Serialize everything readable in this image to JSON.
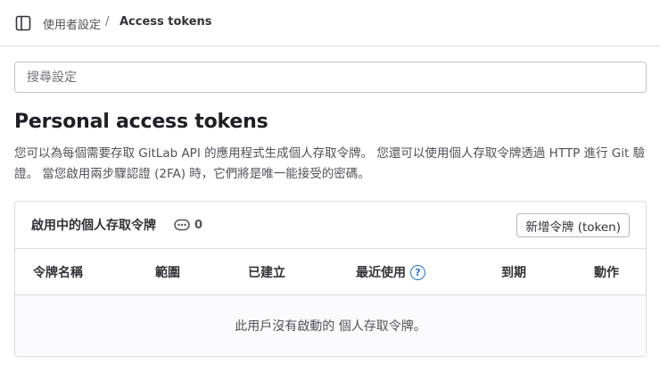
{
  "breadcrumb": {
    "parent": "使用者設定",
    "separator": "/",
    "current": "Access tokens"
  },
  "search": {
    "placeholder": "搜尋設定",
    "value": ""
  },
  "page": {
    "title": "Personal access tokens",
    "description": "您可以為每個需要存取 GitLab API 的應用程式生成個人存取令牌。 您還可以使用個人存取令牌透過 HTTP 進行 Git 驗證。 當您啟用兩步驟認證 (2FA) 時，它們將是唯一能接受的密碼。"
  },
  "tokens_card": {
    "title": "啟用中的個人存取令牌",
    "count": "0",
    "count_icon": "token-icon",
    "add_button": "新增令牌 (token)",
    "columns": {
      "name": "令牌名稱",
      "scopes": "範圍",
      "created": "已建立",
      "last_used": "最近使用",
      "expires": "到期",
      "actions": "動作"
    },
    "empty_message": "此用戶沒有啟動的 個人存取令牌。"
  },
  "colors": {
    "accent": "#1f75cb",
    "border": "#dcdcde",
    "text": "#333238",
    "muted": "#535158"
  }
}
